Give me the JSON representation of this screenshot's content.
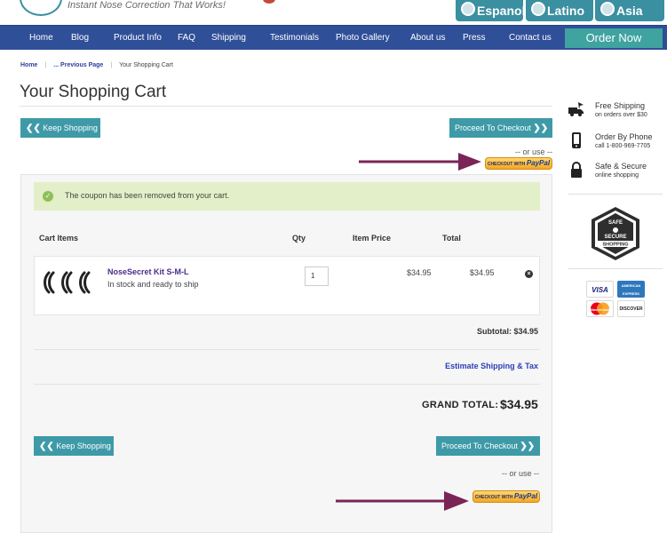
{
  "header": {
    "tagline": "Instant Nose Correction That Works!",
    "languages": [
      {
        "label": "Espanol"
      },
      {
        "label": "Latino"
      },
      {
        "label": "Asia"
      }
    ]
  },
  "nav": {
    "items": [
      "Home",
      "Blog",
      "Product Info",
      "FAQ",
      "Shipping",
      "Testimonials",
      "Photo Gallery",
      "About us",
      "Press",
      "Contact us"
    ],
    "order_now": "Order Now"
  },
  "breadcrumb": {
    "home": "Home",
    "previous": "... Previous Page",
    "current": "Your Shopping Cart"
  },
  "page_title": "Your Shopping Cart",
  "actions": {
    "keep_shopping": "Keep Shopping",
    "proceed_checkout": "Proceed To Checkout",
    "or_use": "-- or use --",
    "paypal_prefix": "CHECKOUT WITH",
    "paypal_brand": "PayPal"
  },
  "cart": {
    "coupon_message": "The coupon has been removed from your cart.",
    "columns": {
      "items": "Cart Items",
      "qty": "Qty",
      "item_price": "Item Price",
      "total": "Total"
    },
    "items": [
      {
        "name": "NoseSecret Kit S-M-L",
        "stock": "In stock and ready to ship",
        "qty": "1",
        "item_price": "$34.95",
        "total": "$34.95"
      }
    ],
    "subtotal": "Subtotal: $34.95",
    "estimate_shipping": "Estimate Shipping & Tax",
    "grand_total_label": "GRAND TOTAL:",
    "grand_total_value": "$34.95"
  },
  "sidebar": {
    "features": [
      {
        "title": "Free Shipping",
        "subtitle": "on orders over $30",
        "icon": "truck-icon"
      },
      {
        "title": "Order By Phone",
        "subtitle": "call 1-800-969-7705",
        "icon": "phone-icon"
      },
      {
        "title": "Safe & Secure",
        "subtitle": "online shopping",
        "icon": "lock-icon"
      }
    ],
    "seal": {
      "line1": "SAFE",
      "line2": "SECURE",
      "line3": "SHOPPING"
    },
    "cards": [
      "VISA",
      "AMERICAN EXPRESS",
      "MasterCard",
      "DISCOVER"
    ]
  },
  "colors": {
    "nav_bg": "#2f4f98",
    "teal": "#3f9aa8",
    "coupon_bg": "#e3efc8",
    "arrow": "#7a2458",
    "link_purple": "#4a2b8a"
  }
}
